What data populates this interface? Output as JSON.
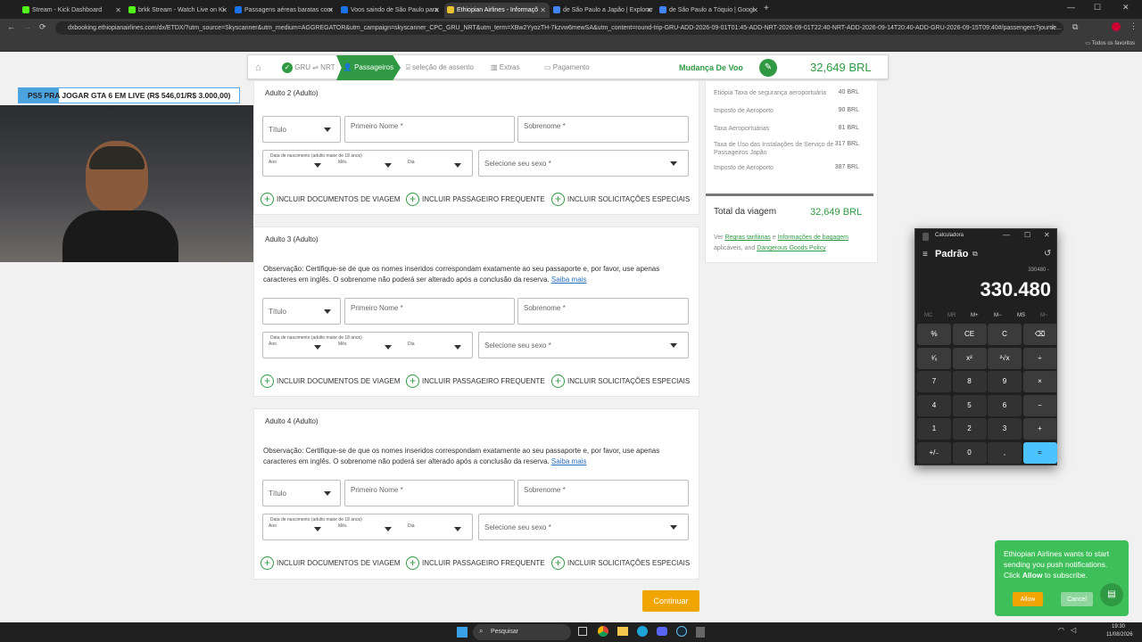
{
  "browser": {
    "tabs": [
      {
        "label": "Stream - Kick Dashboard",
        "fav": "#53fc18"
      },
      {
        "label": "brkk Stream - Watch Live on Ki",
        "fav": "#53fc18"
      },
      {
        "label": "Passagens aéreas baratas com",
        "fav": "#1a73e8"
      },
      {
        "label": "Voos saindo de São Paulo para",
        "fav": "#1a73e8"
      },
      {
        "label": "Ethiopian Airlines - Informaçõ",
        "fav": "#e8c230"
      },
      {
        "label": "de São Paulo a Japão | Explorar",
        "fav": "#4285f4"
      },
      {
        "label": "de São Paulo a Tóquio | Googl",
        "fav": "#4285f4"
      }
    ],
    "url": "dxbooking.ethiopianairlines.com/dx/ETDX/?utm_source=Skyscanner&utm_medium=AGGREGATOR&utm_campaign=skyscanner_CPC_GRU_NRT&utm_term=XBw2YyozTH-7kzvw6mewSA&utm_content=round-trip-GRU-ADD-2026-09-01T01:45-ADD-NRT-2026-09-01T22:40-NRT-ADD-2026-09-14T20:40-ADD-GRU-2026-09-15T09:40#/passengers?journe...",
    "bookmarks_label": "Todos os favoritos"
  },
  "stepper": {
    "route": "GRU ⇌ NRT",
    "passengers": "Passageiros",
    "seat": "seleção de assento",
    "extras": "Extras",
    "payment": "Pagamento",
    "change": "Mudança De Voo",
    "total": "32,649 BRL"
  },
  "stream_banner": "PS5 PRA JOGAR GTA 6 EM LIVE (R$ 546,01/R$ 3.000,00)",
  "form": {
    "title_label": "Título",
    "first_name": "Primeiro Nome *",
    "last_name": "Sobrenome *",
    "dob_label": "Data de nascimento (adulto maior de 18 anos)",
    "year": "Ano",
    "month": "Mês",
    "day": "Dia",
    "gender": "Selecione seu sexo *",
    "docs": "INCLUIR DOCUMENTOS DE VIAGEM",
    "frequent": "INCLUIR PASSAGEIRO FREQUENTE",
    "special": "INCLUIR SOLICITAÇÕES ESPECIAIS",
    "note_text": "Observação:  Certifique-se de que os nomes inseridos correspondam exatamente ao seu passaporte e, por favor, use apenas caracteres em inglês. O sobrenome não poderá ser alterado após a conclusão da reserva.",
    "note_link": "Saiba mais",
    "continue": "Continuar",
    "adults": [
      "Adulto 2 (Adulto)",
      "Adulto 3 (Adulto)",
      "Adulto 4 (Adulto)"
    ]
  },
  "summary": {
    "rows": [
      {
        "label": "Etiópia Taxa de segurança aeroportuária",
        "value": "40 BRL"
      },
      {
        "label": "Imposto de Aeroporto",
        "value": "90 BRL"
      },
      {
        "label": "Taxa Aeroportuárias",
        "value": "81 BRL"
      },
      {
        "label": "Taxa de Uso das Instalações de Serviço de Passageiros Japão",
        "value": "317 BRL"
      },
      {
        "label": "Imposto de Aeroporto",
        "value": "387 BRL"
      }
    ],
    "total_label": "Total da viagem",
    "total_value": "32,649 BRL",
    "foot_pre": "Ver ",
    "fare_rules": "Regras tarifárias",
    "and": " e ",
    "baggage": "Informações de bagagem",
    "applicable": " aplicáveis, and ",
    "dangerous": "Dangerous Goods Policy"
  },
  "calculator": {
    "title": "Calculadora",
    "mode": "Padrão",
    "expression": "330480 -",
    "display": "330.480",
    "memory": [
      "MC",
      "MR",
      "M+",
      "M−",
      "MS",
      "M~"
    ],
    "keys": [
      "%",
      "CE",
      "C",
      "⌫",
      "¹⁄ₓ",
      "x²",
      "²√x",
      "÷",
      "7",
      "8",
      "9",
      "×",
      "4",
      "5",
      "6",
      "−",
      "1",
      "2",
      "3",
      "+",
      "+/₋",
      "0",
      ",",
      "="
    ]
  },
  "notification": {
    "text_pre": "Ethiopian Airlines wants to start sending you push notifications. Click ",
    "text_bold": "Allow",
    "text_post": " to subscribe.",
    "allow": "Allow",
    "cancel": "Cancel"
  },
  "taskbar": {
    "search": "Pesquisar",
    "time": "19:30",
    "date": "11/08/2026"
  }
}
